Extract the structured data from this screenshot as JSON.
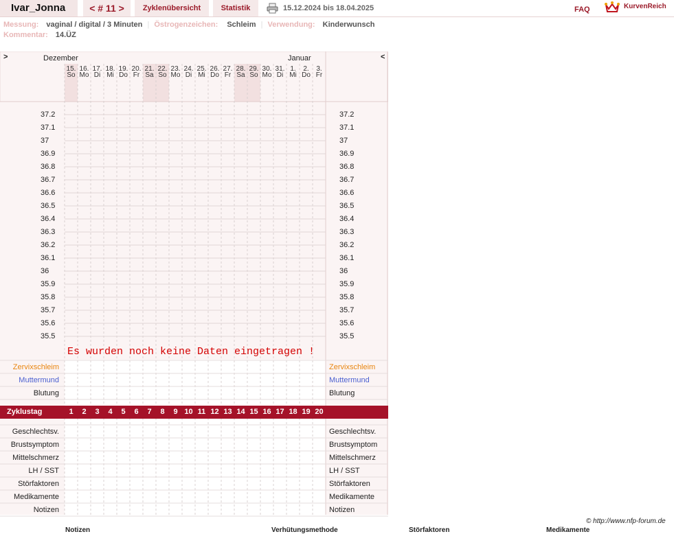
{
  "header": {
    "user": "Ivar_Jonna",
    "cycle": "< # 11 >",
    "tab_overview": "Zyklenübersicht",
    "tab_stats": "Statistik",
    "date_range": "15.12.2024 bis 18.04.2025",
    "faq": "FAQ",
    "brand": "KurvenReich"
  },
  "meta": {
    "messung_label": "Messung:",
    "messung_value": "vaginal / digital / 3 Minuten",
    "oestrogen_label": "Östrogenzeichen:",
    "oestrogen_value": "Schleim",
    "verwendung_label": "Verwendung:",
    "verwendung_value": "Kinderwunsch",
    "kommentar_label": "Kommentar:",
    "kommentar_value": "14.ÜZ"
  },
  "chart": {
    "nav_prev": ">",
    "nav_next": "<",
    "month_left": "Dezember",
    "month_right": "Januar",
    "day_numbers": [
      "15.",
      "16.",
      "17.",
      "18.",
      "19.",
      "20.",
      "21.",
      "22.",
      "23.",
      "24.",
      "25.",
      "26.",
      "27.",
      "28.",
      "29.",
      "30.",
      "31.",
      "1.",
      "2.",
      "3."
    ],
    "weekdays": [
      "So",
      "Mo",
      "Di",
      "Mi",
      "Do",
      "Fr",
      "Sa",
      "So",
      "Mo",
      "Di",
      "Mi",
      "Do",
      "Fr",
      "Sa",
      "So",
      "Mo",
      "Di",
      "Mi",
      "Do",
      "Fr"
    ],
    "weekend_indices": [
      0,
      6,
      7,
      13,
      14
    ],
    "temperatures": [
      "37.2",
      "37.1",
      "37",
      "36.9",
      "36.8",
      "36.7",
      "36.6",
      "36.5",
      "36.4",
      "36.3",
      "36.2",
      "36.1",
      "36",
      "35.9",
      "35.8",
      "35.7",
      "35.6",
      "35.5"
    ],
    "empty_message": "Es wurden noch keine Daten eingetragen !",
    "rows_top": [
      {
        "label": "Zervixschleim",
        "color": "#e8850f"
      },
      {
        "label": "Muttermund",
        "color": "#4a5fd0"
      },
      {
        "label": "Blutung",
        "color": "#222222"
      }
    ],
    "cycle_label": "Zyklustag",
    "cycle_days": [
      "1",
      "2",
      "3",
      "4",
      "5",
      "6",
      "7",
      "8",
      "9",
      "10",
      "11",
      "12",
      "13",
      "14",
      "15",
      "16",
      "17",
      "18",
      "19",
      "20"
    ],
    "rows_bottom": [
      "Geschlechtsv.",
      "Brustsymptom",
      "Mittelschmerz",
      "LH / SST",
      "Störfaktoren",
      "Medikamente",
      "Notizen"
    ]
  },
  "footer": {
    "copyright": "© http://www.nfp-forum.de",
    "col1": "Notizen",
    "col2": "Verhütungsmethode",
    "col3": "Störfaktoren",
    "col4": "Medikamente"
  },
  "colors": {
    "accent": "#9b1b2a",
    "tab_bg": "#f5e9e9",
    "cycle_bar": "#a51229"
  },
  "icons": {
    "print": "printer-icon",
    "logo": "crown-heart-icon"
  }
}
